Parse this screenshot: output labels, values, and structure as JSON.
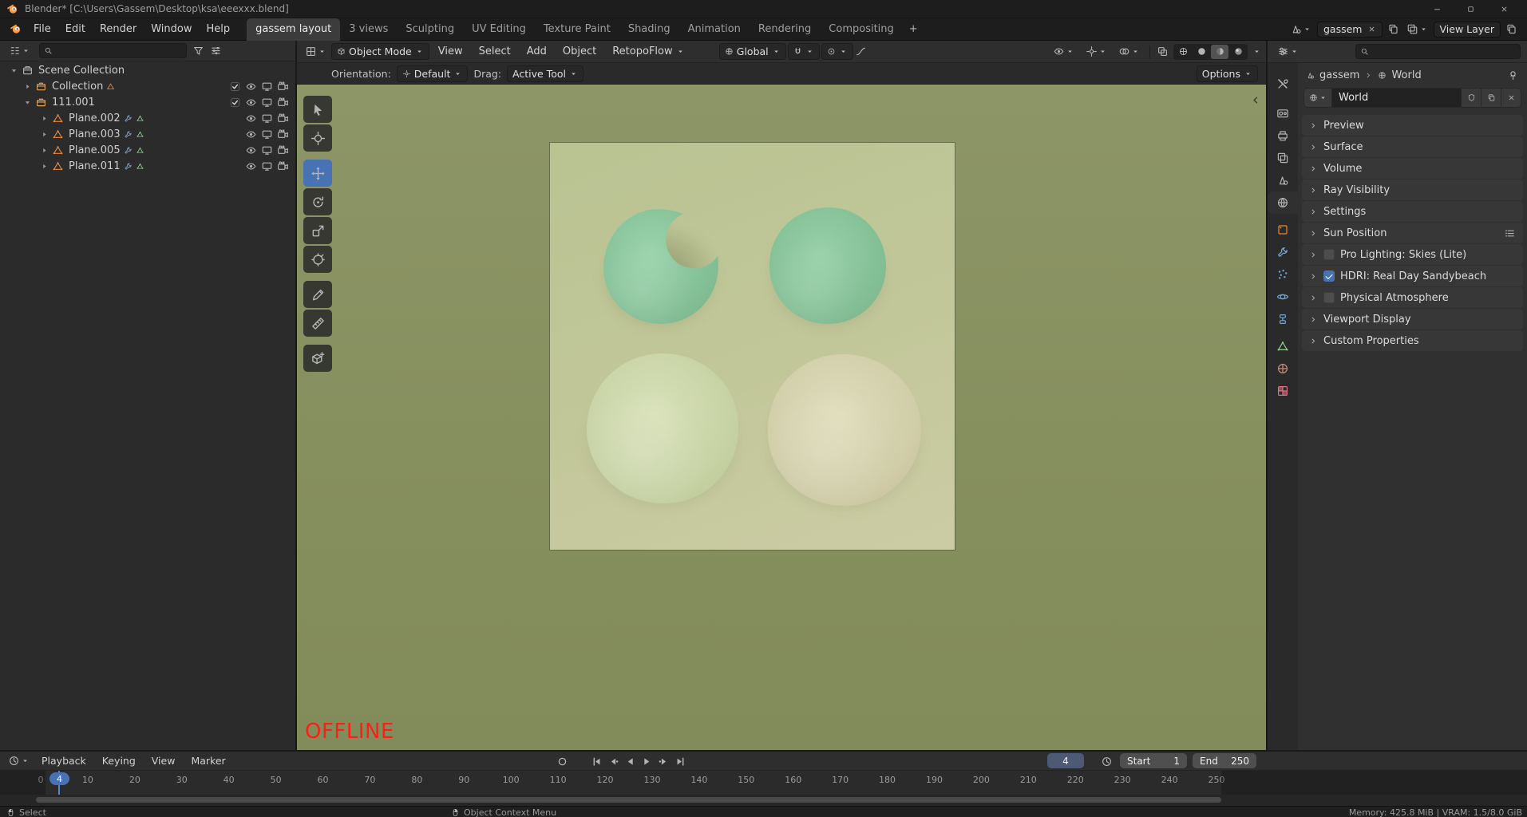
{
  "window": {
    "title": "Blender* [C:\\Users\\Gassem\\Desktop\\ksa\\eeexxx.blend]"
  },
  "topbar": {
    "menus": [
      "File",
      "Edit",
      "Render",
      "Window",
      "Help"
    ],
    "workspaces": [
      "gassem layout",
      "3 views",
      "Sculpting",
      "UV Editing",
      "Texture Paint",
      "Shading",
      "Animation",
      "Rendering",
      "Compositing"
    ],
    "add_tab": "+",
    "scene_name": "gassem",
    "view_layer_name": "View Layer"
  },
  "outliner": {
    "rows": [
      {
        "label": "Scene Collection"
      },
      {
        "label": "Collection"
      },
      {
        "label": "111.001"
      },
      {
        "label": "Plane.002"
      },
      {
        "label": "Plane.003"
      },
      {
        "label": "Plane.005"
      },
      {
        "label": "Plane.011"
      }
    ]
  },
  "viewport": {
    "mode": "Object Mode",
    "menus": [
      "View",
      "Select",
      "Add",
      "Object",
      "RetopoFlow"
    ],
    "orientation": "Global",
    "tool_settings": {
      "orientation_label": "Orientation:",
      "orientation_value": "Default",
      "drag_label": "Drag:",
      "drag_value": "Active Tool",
      "options_label": "Options"
    },
    "offline_label": "OFFLINE"
  },
  "properties": {
    "breadcrumb": {
      "scene": "gassem",
      "datablock": "World"
    },
    "world_name": "World",
    "panels": [
      {
        "label": "Preview"
      },
      {
        "label": "Surface"
      },
      {
        "label": "Volume"
      },
      {
        "label": "Ray Visibility"
      },
      {
        "label": "Settings"
      },
      {
        "label": "Sun Position"
      },
      {
        "label": "Pro Lighting: Skies (Lite)",
        "checkbox": "unchecked"
      },
      {
        "label": "HDRI: Real Day Sandybeach",
        "checkbox": "checked"
      },
      {
        "label": "Physical Atmosphere",
        "checkbox": "unchecked"
      },
      {
        "label": "Viewport Display"
      },
      {
        "label": "Custom Properties"
      }
    ]
  },
  "timeline": {
    "menus": [
      "Playback",
      "Keying",
      "View",
      "Marker"
    ],
    "current_frame": "4",
    "start_label": "Start",
    "start_value": "1",
    "end_label": "End",
    "end_value": "250",
    "ruler": [
      "0",
      "10",
      "20",
      "30",
      "40",
      "50",
      "60",
      "70",
      "80",
      "90",
      "100",
      "110",
      "120",
      "130",
      "140",
      "150",
      "160",
      "170",
      "180",
      "190",
      "200",
      "210",
      "220",
      "230",
      "240",
      "250"
    ]
  },
  "statusbar": {
    "select_hint": "Select",
    "context_hint": "Object Context Menu",
    "stats": "Memory: 425.8 MiB | VRAM: 1.5/8.0 GiB"
  },
  "colors": {
    "accent_blue": "#4772b3",
    "offline_red": "#fe1e17",
    "cookie_green": "#8ac79c",
    "cookie_beige": "#d5d3ae"
  }
}
